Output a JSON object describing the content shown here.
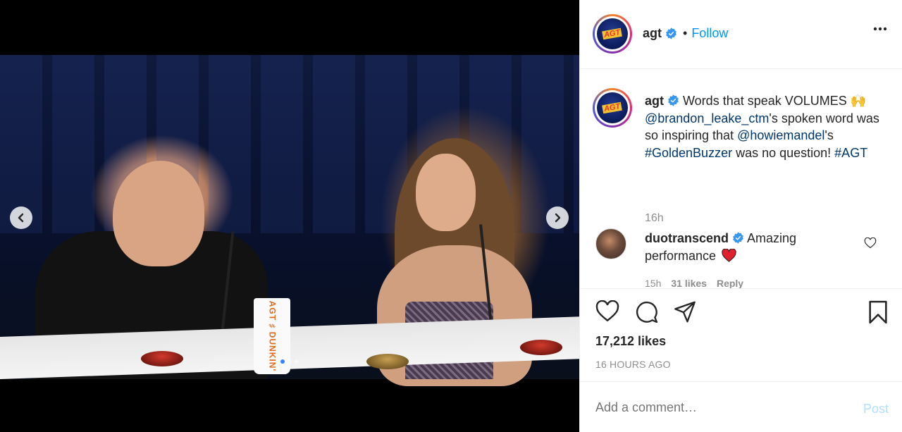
{
  "media": {
    "cup_text": "AGT ♯ DUNKIN'",
    "carousel_dots": 3,
    "active_dot": 1
  },
  "header": {
    "username": "agt",
    "bullet": "•",
    "follow_label": "Follow",
    "avatar_logo_text": "AGT"
  },
  "caption": {
    "username": "agt",
    "text_1": "Words that speak VOLUMES 🙌",
    "mention_1": "@brandon_leake_ctm",
    "text_2": "'s spoken word was so inspiring that ",
    "mention_2": "@howiemandel",
    "text_3": "'s ",
    "hashtag_1": "#GoldenBuzzer",
    "text_4": " was no question! ",
    "hashtag_2": "#AGT",
    "time": "16h"
  },
  "comment": {
    "username": "duotranscend",
    "text": "Amazing performance",
    "time": "15h",
    "likes": "31 likes",
    "reply": "Reply"
  },
  "stats": {
    "likes": "17,212 likes",
    "posted": "16 HOURS AGO"
  },
  "add_comment": {
    "placeholder": "Add a comment…",
    "post_label": "Post"
  },
  "colors": {
    "accent": "#0095f6",
    "post_disabled": "#b2dffc",
    "muted": "#8e8e8e",
    "link": "#00376b"
  }
}
